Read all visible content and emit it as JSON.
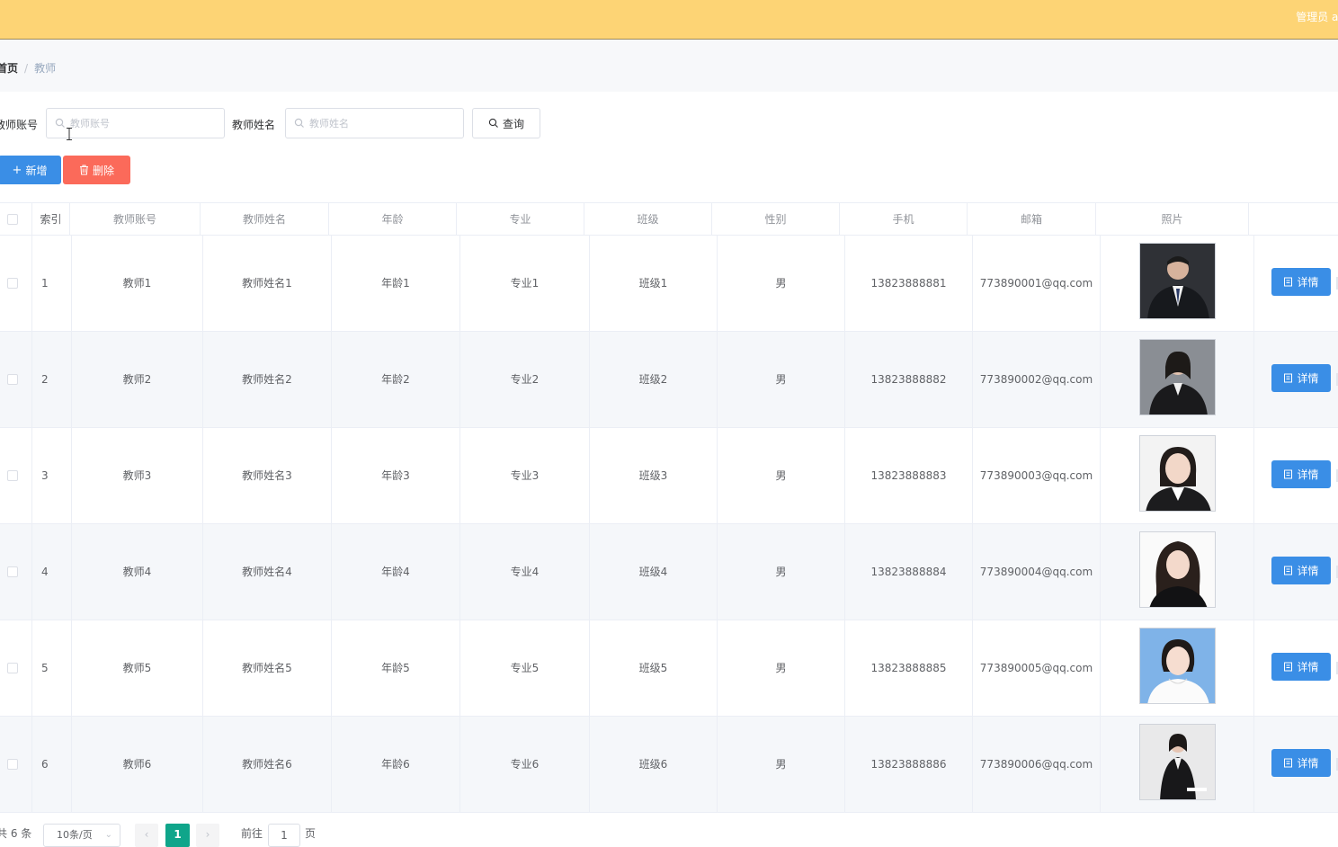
{
  "header": {
    "admin_text": "管理员 ad"
  },
  "breadcrumb": {
    "home": "首页",
    "separator": "/",
    "current": "教师"
  },
  "search": {
    "account_label": "教师账号",
    "account_placeholder": "教师账号",
    "name_label": "教师姓名",
    "name_placeholder": "教师姓名",
    "query_label": "查询"
  },
  "toolbar": {
    "add_label": "新增",
    "delete_label": "删除"
  },
  "table": {
    "headers": [
      "索引",
      "教师账号",
      "教师姓名",
      "年龄",
      "专业",
      "班级",
      "性别",
      "手机",
      "邮箱",
      "照片"
    ],
    "detail_label": "详情",
    "rows": [
      {
        "index": "1",
        "account": "教师1",
        "name": "教师姓名1",
        "age": "年龄1",
        "major": "专业1",
        "class": "班级1",
        "gender": "男",
        "phone": "13823888881",
        "email": "773890001@qq.com"
      },
      {
        "index": "2",
        "account": "教师2",
        "name": "教师姓名2",
        "age": "年龄2",
        "major": "专业2",
        "class": "班级2",
        "gender": "男",
        "phone": "13823888882",
        "email": "773890002@qq.com"
      },
      {
        "index": "3",
        "account": "教师3",
        "name": "教师姓名3",
        "age": "年龄3",
        "major": "专业3",
        "class": "班级3",
        "gender": "男",
        "phone": "13823888883",
        "email": "773890003@qq.com"
      },
      {
        "index": "4",
        "account": "教师4",
        "name": "教师姓名4",
        "age": "年龄4",
        "major": "专业4",
        "class": "班级4",
        "gender": "男",
        "phone": "13823888884",
        "email": "773890004@qq.com"
      },
      {
        "index": "5",
        "account": "教师5",
        "name": "教师姓名5",
        "age": "年龄5",
        "major": "专业5",
        "class": "班级5",
        "gender": "男",
        "phone": "13823888885",
        "email": "773890005@qq.com"
      },
      {
        "index": "6",
        "account": "教师6",
        "name": "教师姓名6",
        "age": "年龄6",
        "major": "专业6",
        "class": "班级6",
        "gender": "男",
        "phone": "13823888886",
        "email": "773890006@qq.com"
      }
    ]
  },
  "pagination": {
    "total_text": "共 6 条",
    "page_size": "10条/页",
    "current_page": "1",
    "goto_label": "前往",
    "goto_value": "1",
    "page_suffix": "页"
  },
  "colors": {
    "header_bg": "#fdd475",
    "primary_button": "#3a8ee6",
    "danger_button": "#fb6a5a",
    "active_page": "#0fa58a"
  }
}
